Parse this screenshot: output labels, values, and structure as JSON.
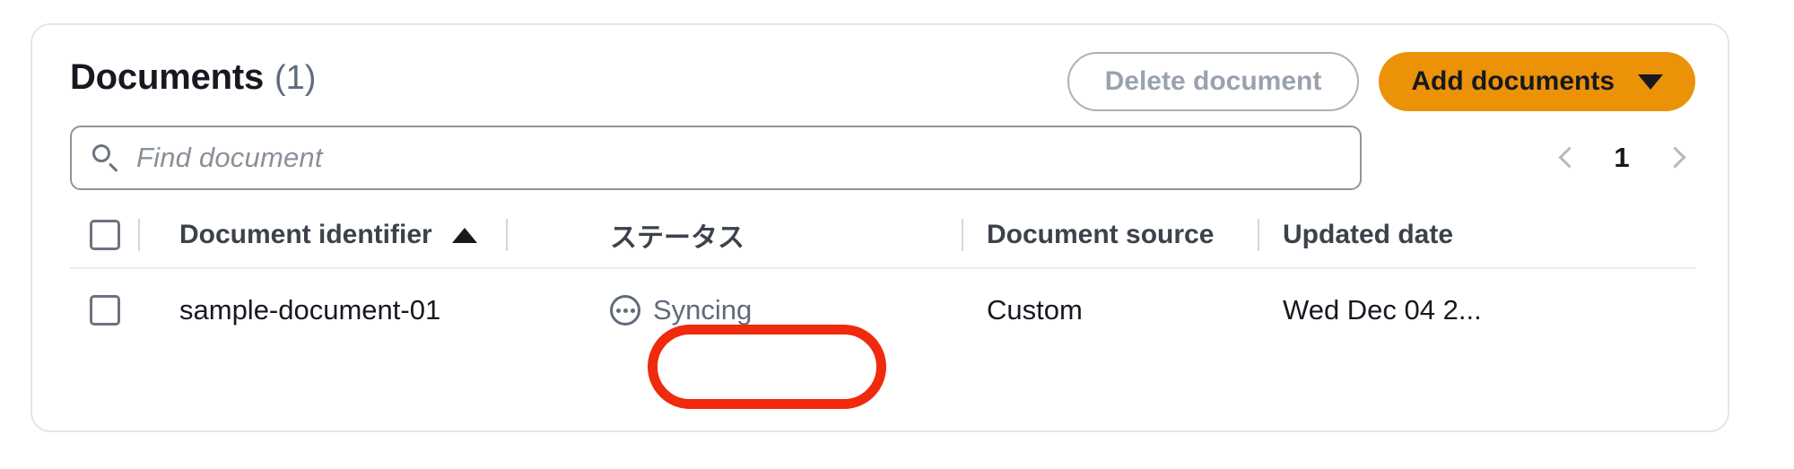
{
  "card": {
    "title": "Documents",
    "count": "(1)",
    "buttons": {
      "delete_label": "Delete document",
      "add_label": "Add documents",
      "add_caret_icon": "chevron-down-icon"
    },
    "search": {
      "icon": "search-icon",
      "placeholder": "Find document",
      "value": ""
    },
    "pagination": {
      "prev_icon": "chevron-left-icon",
      "next_icon": "chevron-right-icon",
      "current_page": "1"
    },
    "table": {
      "columns": [
        {
          "label": "Document identifier",
          "sort": "ascending",
          "sort_icon": "triangle-up-icon"
        },
        {
          "label": "ステータス",
          "sort": "none"
        },
        {
          "label": "Document source",
          "sort": "none"
        },
        {
          "label": "Updated date",
          "sort": "none"
        }
      ],
      "rows": [
        {
          "identifier": "sample-document-01",
          "status": "Syncing",
          "status_icon": "in-progress-icon",
          "source": "Custom",
          "updated_date": "Wed Dec 04 2..."
        }
      ]
    },
    "colors": {
      "accent_orange": "#ec9208",
      "annotation_red": "#f02a0c",
      "text_primary": "#16191f",
      "text_secondary": "#5f6b7a",
      "border": "#e4e5e7"
    },
    "annotation": {
      "shape": "oval-highlight",
      "target": "status-cell"
    }
  }
}
